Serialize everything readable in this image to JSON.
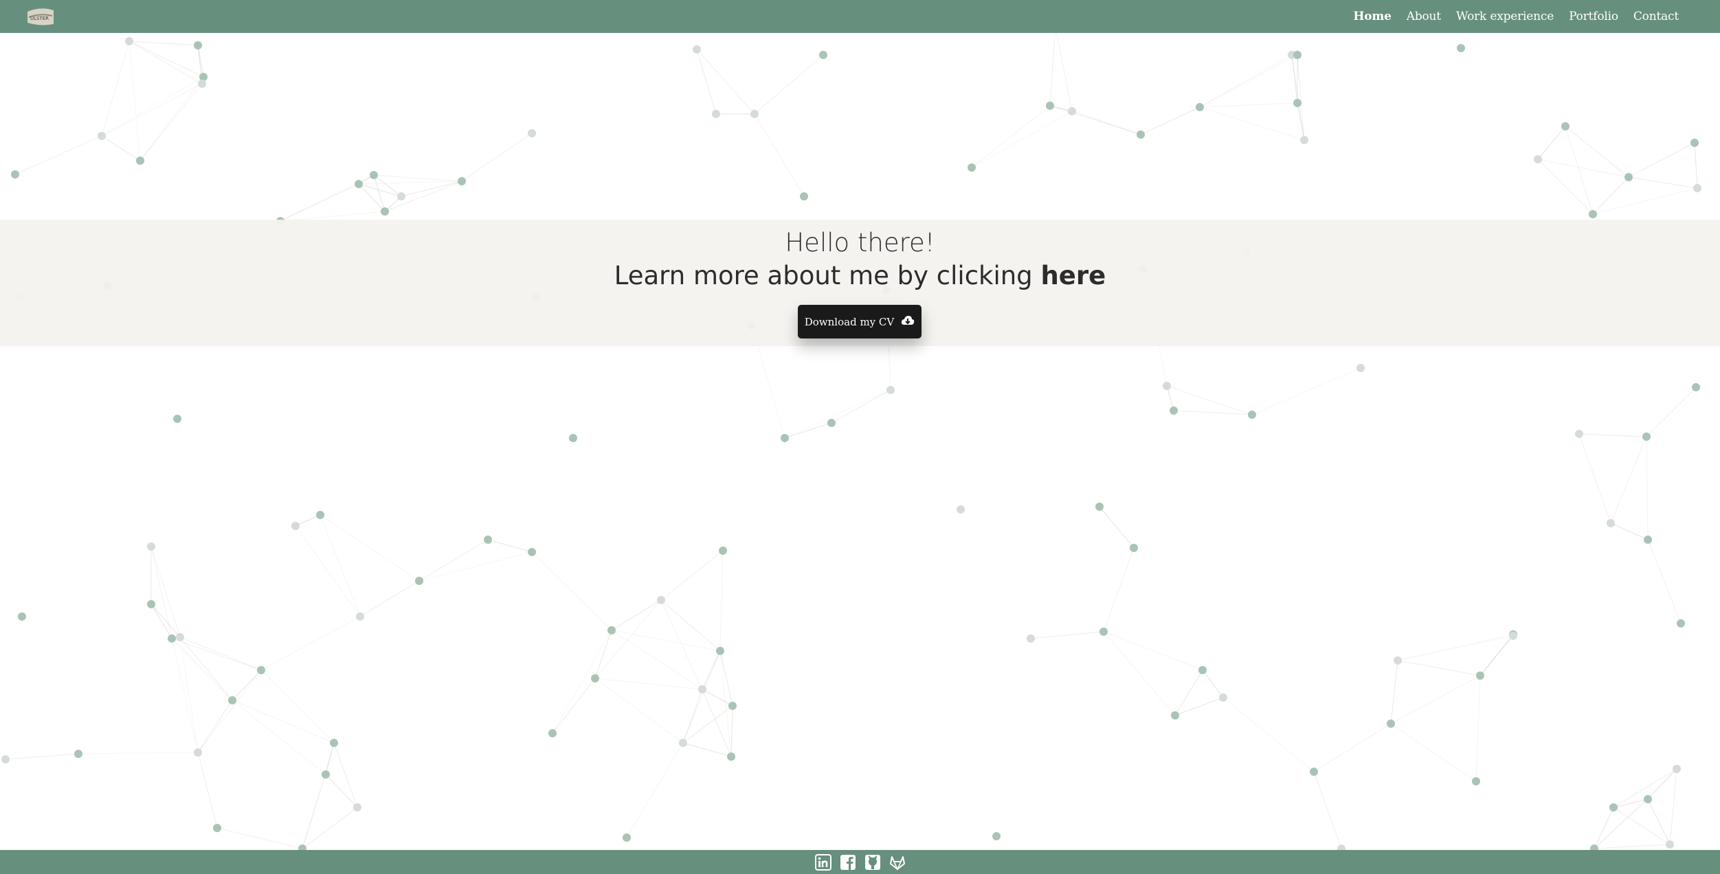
{
  "nav": {
    "logo_icon": "ulster-logo-icon",
    "links": [
      "Home",
      "About",
      "Work experience",
      "Portfolio",
      "Contact"
    ],
    "active": "Home"
  },
  "hero": {
    "greeting": "Hello there!",
    "learn_prefix": "Learn more about me by clicking ",
    "learn_link": "here",
    "cv_button": "Download my CV",
    "cv_icon": "cloud-download-icon"
  },
  "footer": {
    "social_icons": [
      "linkedin-icon",
      "facebook-icon",
      "github-icon",
      "gitlab-icon"
    ]
  },
  "colors": {
    "primary": "#668f7e",
    "node": "#a9c4b5",
    "button": "#1a1a1a",
    "hero_band": "#f4f2ef"
  }
}
